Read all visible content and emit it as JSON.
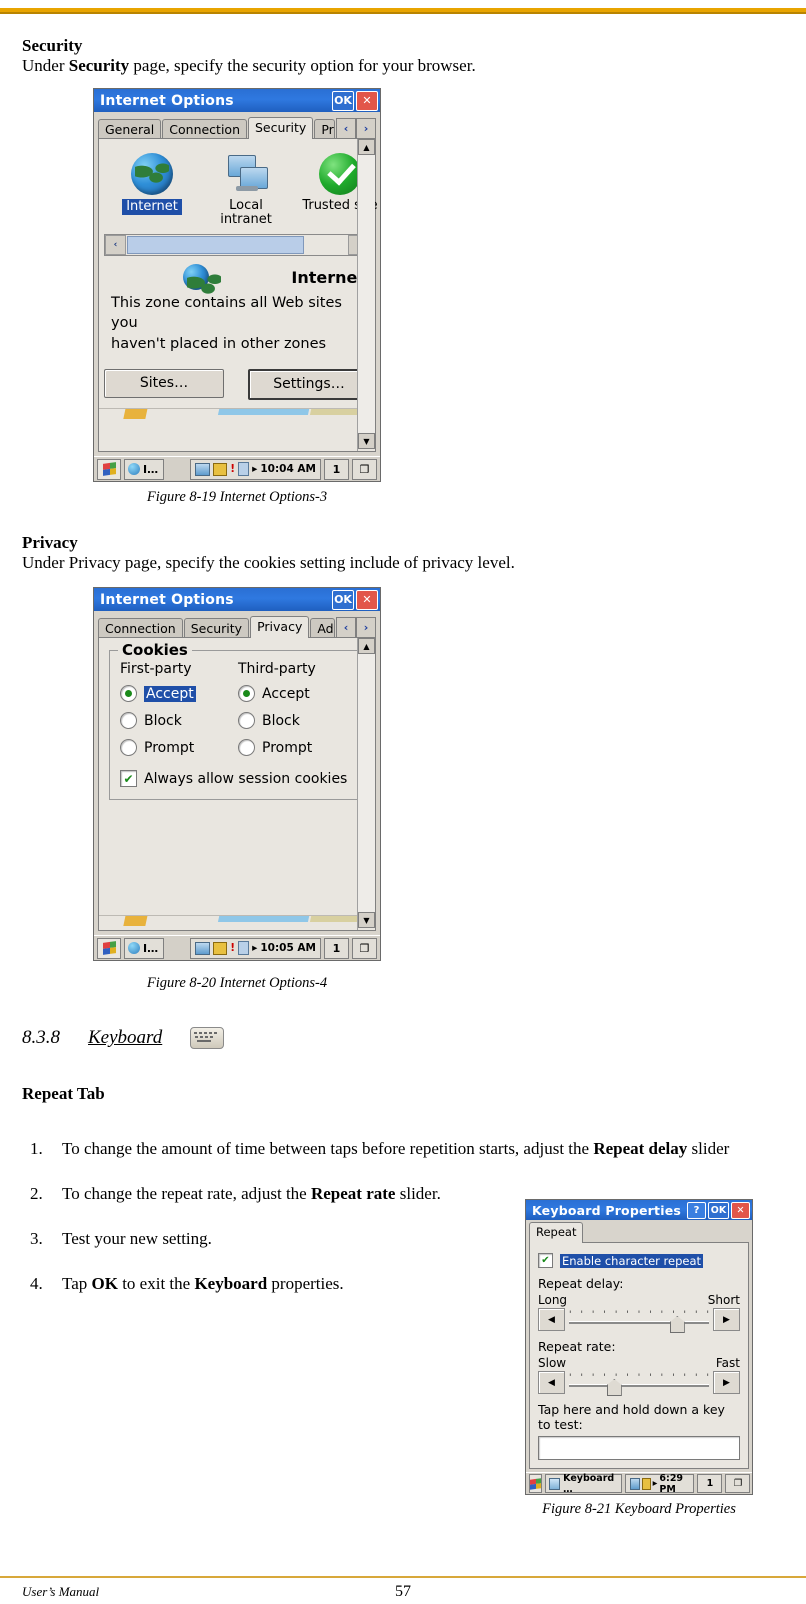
{
  "sections": {
    "security": {
      "heading": "Security",
      "text_before": "Under ",
      "text_bold": "Security",
      "text_after": " page, specify the security option for your browser.",
      "caption": "Figure 8-19 Internet Options-3"
    },
    "privacy": {
      "heading": "Privacy",
      "text": "Under Privacy page, specify the cookies setting include of privacy level.",
      "caption": "Figure 8-20 Internet Options-4"
    },
    "keyboard": {
      "number": "8.3.8",
      "title": "Keyboard",
      "subheading": "Repeat Tab",
      "steps": [
        {
          "num": "1.",
          "parts": [
            "To change the amount of time between taps before repetition starts, adjust the ",
            "Repeat delay",
            " slider"
          ]
        },
        {
          "num": "2.",
          "parts": [
            "To change the repeat rate, adjust the ",
            "Repeat rate",
            " slider."
          ]
        },
        {
          "num": "3.",
          "parts": [
            "Test your new setting.",
            "",
            ""
          ]
        },
        {
          "num": "4.",
          "parts": [
            "Tap ",
            "OK",
            " to exit the "
          ],
          "extra_bold": "Keyboard",
          "extra_tail": " properties."
        }
      ],
      "caption": "Figure 8-21 Keyboard Properties"
    }
  },
  "dialog_security": {
    "title": "Internet Options",
    "ok_label": "OK",
    "close_label": "✕",
    "tabs": [
      {
        "label": "General",
        "active": false
      },
      {
        "label": "Connection",
        "active": false
      },
      {
        "label": "Security",
        "active": true
      },
      {
        "label": "Pri",
        "active": false
      }
    ],
    "tab_prev": "‹",
    "tab_next": "›",
    "zones": [
      {
        "name": "Internet",
        "selected": true,
        "icon": "globe-icon"
      },
      {
        "name": "Local intranet",
        "selected": false,
        "icon": "local-intranet-icon"
      },
      {
        "name": "Trusted site",
        "selected": false,
        "icon": "trusted-sites-icon"
      }
    ],
    "scroll_left": "‹",
    "scroll_right": "›",
    "zone_title": "Internet",
    "zone_desc_line1": "This zone contains all Web sites you",
    "zone_desc_line2": "haven't placed in other zones",
    "buttons": [
      {
        "label": "Sites…",
        "default": false
      },
      {
        "label": "Settings…",
        "default": true
      }
    ],
    "taskbar": {
      "start": "start-icon",
      "task_label": "I…",
      "time": "10:04 AM",
      "input_panel": "1",
      "desktop": "❐"
    }
  },
  "dialog_privacy": {
    "title": "Internet Options",
    "ok_label": "OK",
    "close_label": "✕",
    "tabs": [
      {
        "label": "Connection",
        "active": false
      },
      {
        "label": "Security",
        "active": false
      },
      {
        "label": "Privacy",
        "active": true
      },
      {
        "label": "Ad",
        "active": false
      }
    ],
    "tab_prev": "‹",
    "tab_next": "›",
    "group_title": "Cookies",
    "col1_header": "First-party",
    "col2_header": "Third-party",
    "first_party": [
      {
        "label": "Accept",
        "checked": true
      },
      {
        "label": "Block",
        "checked": false
      },
      {
        "label": "Prompt",
        "checked": false
      }
    ],
    "third_party": [
      {
        "label": "Accept",
        "checked": true
      },
      {
        "label": "Block",
        "checked": false
      },
      {
        "label": "Prompt",
        "checked": false
      }
    ],
    "always_allow": {
      "label": "Always allow session cookies",
      "checked": true,
      "check_glyph": "✔"
    },
    "taskbar": {
      "task_label": "I…",
      "time": "10:05 AM",
      "input_panel": "1",
      "desktop": "❐"
    }
  },
  "dialog_keyboard": {
    "title": "Keyboard Properties",
    "help_label": "?",
    "ok_label": "OK",
    "close_label": "✕",
    "tabs": [
      {
        "label": "Repeat",
        "active": true
      }
    ],
    "enable_repeat": {
      "label": "Enable character repeat",
      "checked": true,
      "check_glyph": "✔"
    },
    "repeat_delay_label": "Repeat delay:",
    "delay_min": "Long",
    "delay_max": "Short",
    "delay_value_pct": 72,
    "repeat_rate_label": "Repeat rate:",
    "rate_min": "Slow",
    "rate_max": "Fast",
    "rate_value_pct": 27,
    "test_label": "Tap here and hold down a key to test:",
    "test_value": "",
    "taskbar": {
      "task_label": "Keyboard …",
      "time": "6:29 PM",
      "input_panel": "1",
      "desktop": "❐"
    }
  },
  "footer": {
    "left": "User’s Manual",
    "page": "57"
  }
}
